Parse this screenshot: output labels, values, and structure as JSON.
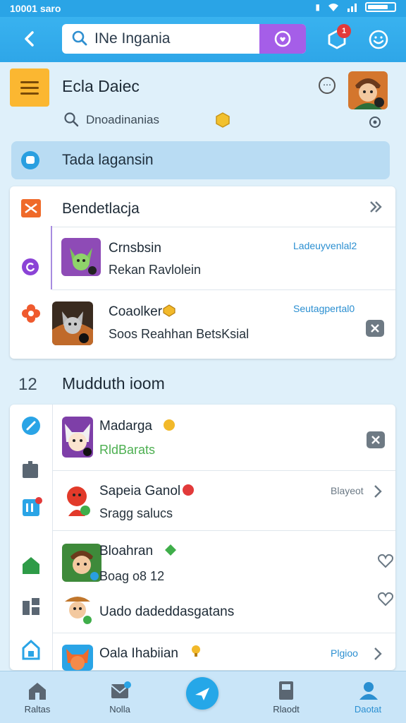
{
  "status_bar": {
    "time": "10001 saro"
  },
  "search": {
    "value": "INe Ingania"
  },
  "notifications": {
    "count": "1"
  },
  "profile": {
    "name": "Ecla Daiec",
    "sub_label": "Dnoadinanias"
  },
  "banner": {
    "text": "Tada lagansin"
  },
  "card1": {
    "title": "Bendetlacja",
    "rows": [
      {
        "title": "Crnsbsin",
        "subtitle": "Rekan Ravlolein",
        "tag": "Ladeuyvenlal2"
      },
      {
        "title": "Coaolker",
        "subtitle": "Soos Reahhan BetsKsial",
        "tag": "Seutagpertal0"
      }
    ]
  },
  "section": {
    "title": "Mudduth ioom",
    "icon_text": "12"
  },
  "card2": {
    "rows": [
      {
        "title": "Madarga",
        "subtitle": "RldBarats"
      },
      {
        "title": "Sapeia Ganol",
        "subtitle": "Sragg salucs",
        "tag": "Blayeot"
      },
      {
        "title": "Bloahran",
        "subtitle": "Boag o8 12"
      },
      {
        "title": "Uado dadeddasgatans"
      },
      {
        "title": "Oala Ihabiian",
        "tag": "Plgioo"
      }
    ]
  },
  "bottom_nav": {
    "items": [
      {
        "label": "Raltas"
      },
      {
        "label": "Nolla"
      },
      {
        "label": "Rlaodt"
      },
      {
        "label": "Daotat"
      }
    ]
  },
  "colors": {
    "accent": "#2aa4e6",
    "banner": "#b9dcf3",
    "menu_button": "#fbb731",
    "mic_button": "#a55ee8",
    "badge": "#e23a3a"
  }
}
